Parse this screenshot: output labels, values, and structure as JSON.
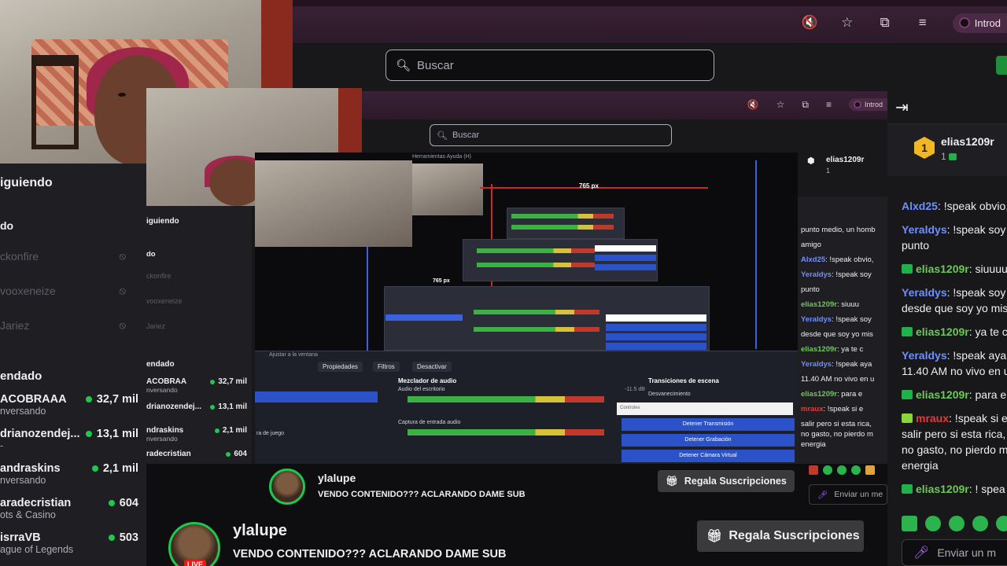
{
  "browser": {
    "profile_label": "Introd",
    "icons": [
      "muted-tab-icon",
      "star-icon",
      "extensions-icon",
      "media-icon"
    ]
  },
  "header": {
    "search_placeholder": "Buscar"
  },
  "sidebar": {
    "following_title": "iguiendo",
    "live_subtitle": "do",
    "offline": [
      {
        "name": "ckonfire"
      },
      {
        "name": "vooxeneize"
      },
      {
        "name": "Jariez"
      }
    ],
    "recommended_title": "endado",
    "recommended": [
      {
        "name": "ACOBRAAA",
        "sub": "nversando",
        "count": "32,7 mil"
      },
      {
        "name": "drianozendej...",
        "sub": "",
        "count": "13,1 mil"
      },
      {
        "name": "andraskins",
        "sub": "nversando",
        "count": "2,1 mil"
      },
      {
        "name": "aradecristian",
        "sub": "ots & Casino",
        "count": "604"
      },
      {
        "name": "isrraVB",
        "sub": "ague of Legends",
        "count": "503"
      }
    ]
  },
  "nested": {
    "search_placeholder": "Buscar",
    "profile_label": "Introd",
    "following_title": "iguiendo",
    "live_subtitle": "do",
    "offline": [
      "ckonfire",
      "vooxeneize",
      "Jariez"
    ],
    "recommended_title": "endado",
    "recommended": [
      {
        "name": "ACOBRAA",
        "sub": "nversando",
        "count": "32,7 mil"
      },
      {
        "name": "drianozendej...",
        "sub": "",
        "count": "13,1 mil"
      },
      {
        "name": "ndraskins",
        "sub": "nversando",
        "count": "2,1 mil"
      },
      {
        "name": "radecristian",
        "sub": "ots & Casino",
        "count": "604"
      },
      {
        "name": "isrraVB",
        "sub": "ague of Legends",
        "count": "503"
      }
    ],
    "obs": {
      "menu": "Herramientas   Ayuda (H)",
      "dim1": "765 px",
      "dim2": "765 px",
      "props": "Propiedades",
      "filters": "Filtros",
      "deactivate": "Desactivar",
      "audio_mixer": "Mezclador de audio",
      "desktop_audio": "Audio del escritorio",
      "mic_capture": "Captura de entrada audio",
      "scene_transitions": "Transiciones de escena",
      "fade": "Desvanecimiento",
      "stop_stream": "Detener Transmisión",
      "stop_recording": "Detener Grabación",
      "stop_vcam": "Detener Cámara Virtual",
      "game_capture": "ra de juego",
      "fit_window": "Ajustar a la ventana",
      "db": "-11.5 dB",
      "controls": "Controles"
    },
    "stream_name": "ylalupe",
    "stream_title": "VENDO CONTENIDO??? ACLARANDO DAME SUB",
    "gift_label": "Regala Suscripciones",
    "chat_pinned_user": "elias1209r",
    "chat_pinned_count": "1",
    "chat": [
      {
        "text": "punto medio, un homb"
      },
      {
        "text": "amigo"
      },
      {
        "user": "Alxd25",
        "text": ": !speak obvio,",
        "color": "blue"
      },
      {
        "user": "Yeraldys",
        "text": ": !speak soy",
        "color": "blue"
      },
      {
        "text": "punto"
      },
      {
        "user": "elias1209r",
        "text": ": siuuu",
        "color": "green"
      },
      {
        "user": "Yeraldys",
        "text": ": !speak soy",
        "color": "blue"
      },
      {
        "text": "desde que soy yo mis"
      },
      {
        "user": "elias1209r",
        "text": ": ya te c",
        "color": "green"
      },
      {
        "user": "Yeraldys",
        "text": ": !speak aya",
        "color": "blue"
      },
      {
        "text": "11.40 AM no vivo en u"
      },
      {
        "user": "elias1209r",
        "text": ": para e",
        "color": "green"
      },
      {
        "user": "mraux",
        "text": ": !speak si e",
        "color": "red"
      },
      {
        "text": "salir pero si esta rica,"
      },
      {
        "text": "no gasto, no pierdo m"
      },
      {
        "text": "energia"
      }
    ],
    "chat_input": "Enviar un me"
  },
  "stream": {
    "name": "ylalupe",
    "title": "VENDO CONTENIDO??? ACLARANDO DAME SUB",
    "gift_label": "Regala Suscripciones",
    "live_badge": "LIVE"
  },
  "chat": {
    "pinned_user": "elias1209r",
    "pinned_count": "1",
    "badge_number": "1",
    "messages": [
      {
        "user": "Alxd25",
        "text": ": !speak obvio,",
        "color": "blue",
        "emote": false
      },
      {
        "user": "Yeraldys",
        "text": ": !speak soy",
        "color": "blue",
        "emote": false,
        "cont": "punto"
      },
      {
        "user": "elias1209r",
        "text": ": siuuuu",
        "color": "green",
        "emote": true
      },
      {
        "user": "Yeraldys",
        "text": ": !speak soy",
        "color": "blue",
        "emote": false,
        "cont": "desde que soy yo mis"
      },
      {
        "user": "elias1209r",
        "text": ": ya te c",
        "color": "green",
        "emote": true
      },
      {
        "user": "Yeraldys",
        "text": ": !speak aya",
        "color": "blue",
        "emote": false,
        "cont": "11.40 AM no vivo en u"
      },
      {
        "user": "elias1209r",
        "text": ": para e",
        "color": "green",
        "emote": true
      },
      {
        "user": "mraux",
        "text": ": !speak si e",
        "color": "red",
        "emote": true,
        "cont": "salir pero si esta rica,",
        "cont2": "no gasto, no pierdo m",
        "cont3": "energia"
      },
      {
        "user": "elias1209r",
        "text": ": ! spea",
        "color": "green",
        "emote": true
      }
    ],
    "input_placeholder": "Enviar un m"
  },
  "colors": {
    "accent_green": "#1ec84e",
    "user_blue": "#6f8eff",
    "user_green": "#6fc65a",
    "user_red": "#e03c3c",
    "bg": "#0e0e10"
  }
}
